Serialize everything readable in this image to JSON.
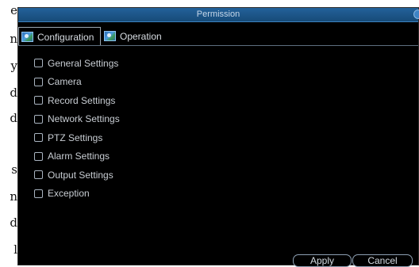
{
  "doc_strip": {
    "letters": [
      "e",
      "n",
      "y",
      "d",
      "d",
      "s",
      "n",
      "d",
      "l"
    ]
  },
  "dialog": {
    "title": "Permission",
    "tabs": [
      {
        "label": "Configuration",
        "active": true,
        "icon": "configuration-icon"
      },
      {
        "label": "Operation",
        "active": false,
        "icon": "operation-icon"
      }
    ],
    "permissions": [
      {
        "label": "General Settings",
        "checked": false
      },
      {
        "label": "Camera",
        "checked": false
      },
      {
        "label": "Record Settings",
        "checked": false
      },
      {
        "label": "Network Settings",
        "checked": false
      },
      {
        "label": "PTZ Settings",
        "checked": false
      },
      {
        "label": "Alarm Settings",
        "checked": false
      },
      {
        "label": "Output Settings",
        "checked": false
      },
      {
        "label": "Exception",
        "checked": false
      }
    ],
    "buttons": {
      "apply": "Apply",
      "cancel": "Cancel"
    },
    "colors": {
      "titlebar": "#1f5a8f",
      "background": "#000000",
      "text": "#c8cdd3"
    }
  }
}
